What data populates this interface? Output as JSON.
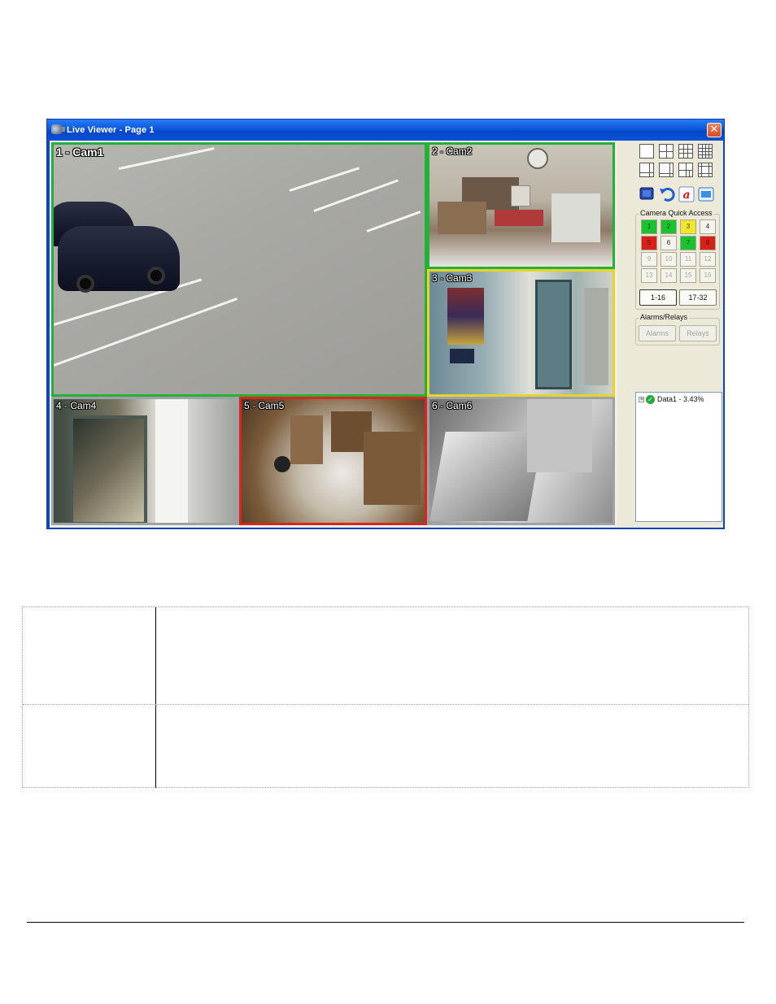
{
  "window": {
    "title": "Live Viewer - Page 1",
    "close_glyph": "✕"
  },
  "cameras": [
    {
      "id": 1,
      "label": "1 - Cam1",
      "status_color": "#25b03a"
    },
    {
      "id": 2,
      "label": "2 - Cam2",
      "status_color": "#25b03a"
    },
    {
      "id": 3,
      "label": "3 - Cam3",
      "status_color": "#e6d42a"
    },
    {
      "id": 4,
      "label": "4 - Cam4",
      "status_color": "#9fa2a4"
    },
    {
      "id": 5,
      "label": "5 - Cam5",
      "status_color": "#d8261f"
    },
    {
      "id": 6,
      "label": "6 - Cam6",
      "status_color": "#9fa2a4"
    }
  ],
  "panel": {
    "layout_buttons": [
      "layout-1x1-icon",
      "layout-2x2-icon",
      "layout-3x3-icon",
      "layout-4x4-icon",
      "layout-1plus5-icon",
      "layout-1plus7-icon",
      "layout-3plus4-icon",
      "layout-1plus12-icon"
    ],
    "tools": [
      "monitor-icon",
      "undo-arrow-icon",
      "alarm-a-icon",
      "view-toggle-icon"
    ],
    "quick_access": {
      "label": "Camera Quick Access",
      "buttons": [
        {
          "n": "1",
          "state": "green"
        },
        {
          "n": "2",
          "state": "green"
        },
        {
          "n": "3",
          "state": "yellow"
        },
        {
          "n": "4",
          "state": "normal"
        },
        {
          "n": "5",
          "state": "red"
        },
        {
          "n": "6",
          "state": "normal"
        },
        {
          "n": "7",
          "state": "green"
        },
        {
          "n": "8",
          "state": "red"
        },
        {
          "n": "9",
          "state": "disabled"
        },
        {
          "n": "10",
          "state": "disabled"
        },
        {
          "n": "11",
          "state": "disabled"
        },
        {
          "n": "12",
          "state": "disabled"
        },
        {
          "n": "13",
          "state": "disabled"
        },
        {
          "n": "14",
          "state": "disabled"
        },
        {
          "n": "15",
          "state": "disabled"
        },
        {
          "n": "16",
          "state": "disabled"
        }
      ],
      "page_buttons": [
        "1-16",
        "17-32"
      ]
    },
    "alarms_relays": {
      "label": "Alarms/Relays",
      "alarms": "Alarms",
      "relays": "Relays"
    },
    "tree": {
      "expander": "+",
      "status_glyph": "✓",
      "item": "Data1 - 3.43%"
    }
  }
}
